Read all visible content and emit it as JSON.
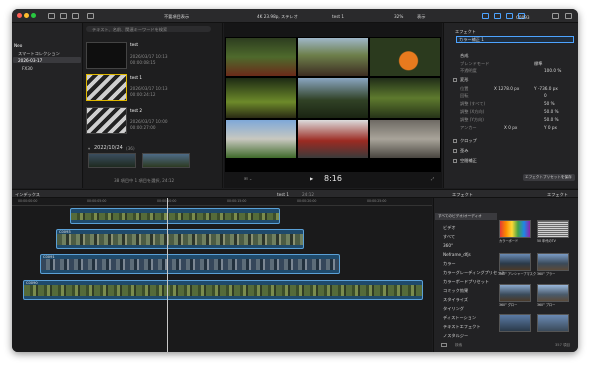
{
  "toolbar": {
    "center_label": "不要項目表示",
    "viewer_info": "4K 23.98p, ステレオ",
    "project_name": "test 1",
    "zoom": "32%",
    "view_label": "表示",
    "timecode_top": "00:00"
  },
  "sidebar": {
    "library": "Neo",
    "items": [
      "スマートコレクション",
      "2026-03-17",
      "FX30"
    ]
  },
  "browser": {
    "search_placeholder": "テキスト、名前、関連キーワードを検索",
    "clips": [
      {
        "title": "test",
        "date": "2026/03/17 10:13",
        "dur": "00:00:08:15"
      },
      {
        "title": "test 1",
        "date": "2026/03/17 10:13",
        "dur": "00:00:24:12"
      },
      {
        "title": "test 2",
        "date": "2026/03/17 10:00",
        "dur": "00:00:27:00"
      }
    ],
    "group_title": "2022/10/24",
    "group_count": "(36)",
    "status": "38 項目中 1 項目を選択, 24:12"
  },
  "viewer": {
    "timecode": "8:16"
  },
  "inspector": {
    "clip_name": "C0093",
    "tabs": [
      "エフェクト"
    ],
    "effect_selected": "カラー補正 1",
    "composite": {
      "header": "合成",
      "blend_label": "ブレンドモード",
      "blend_value": "標準",
      "opacity_label": "不透明度",
      "opacity_value": "100.0 %"
    },
    "transform": {
      "header": "変形",
      "rows": [
        {
          "label": "位置",
          "v1": "X  1278.0 px",
          "v2": "Y  -736.0 px"
        },
        {
          "label": "回転",
          "v1": "0",
          "v2": "0"
        },
        {
          "label": "調整 (すべて)",
          "v1": "",
          "v2": "50 %"
        },
        {
          "label": "調整 (X方向)",
          "v1": "",
          "v2": "50.0 %"
        },
        {
          "label": "調整 (Y方向)",
          "v1": "",
          "v2": "50.0 %"
        },
        {
          "label": "アンカー",
          "v1": "X  0 px",
          "v2": "Y  0 px"
        }
      ]
    },
    "crop": "クロップ",
    "distort": "歪み",
    "spatial": "空間補正",
    "save_preset": "エフェクトプリセットを保存"
  },
  "timeline": {
    "index_label": "インデックス",
    "project": "test 1",
    "duration": "24:12",
    "ruler_ticks": [
      "00:00:00:00",
      "00:00:05:00",
      "00:00:10:00",
      "00:00:15:00",
      "00:00:20:00",
      "00:00:25:00"
    ],
    "clips": [
      {
        "name": "C0093"
      },
      {
        "name": "C0094"
      },
      {
        "name": "C0091"
      },
      {
        "name": "C0090"
      }
    ]
  },
  "effects": {
    "title": "エフェクト",
    "title2": "エフェクト",
    "all_label": "すべてのビデオ/オーディオ",
    "section": "ビデオエフェクト",
    "categories": [
      "ビデオ",
      "すべて",
      "360°",
      "Neframe_dfjs",
      "カラー",
      "カラーグレーディングプリセット",
      "カラーボードプリセット",
      "コミック効果",
      "スタイライズ",
      "タイリング",
      "ディストーション",
      "テキストエフェクト",
      "ノスタルジー"
    ],
    "items": [
      "カラーボード",
      "50 年代のTV",
      "360° アンシャープマスク",
      "360° ブラー",
      "360° グロー",
      "360° ブロー"
    ],
    "count": "357 項目",
    "search_placeholder": "検索"
  }
}
